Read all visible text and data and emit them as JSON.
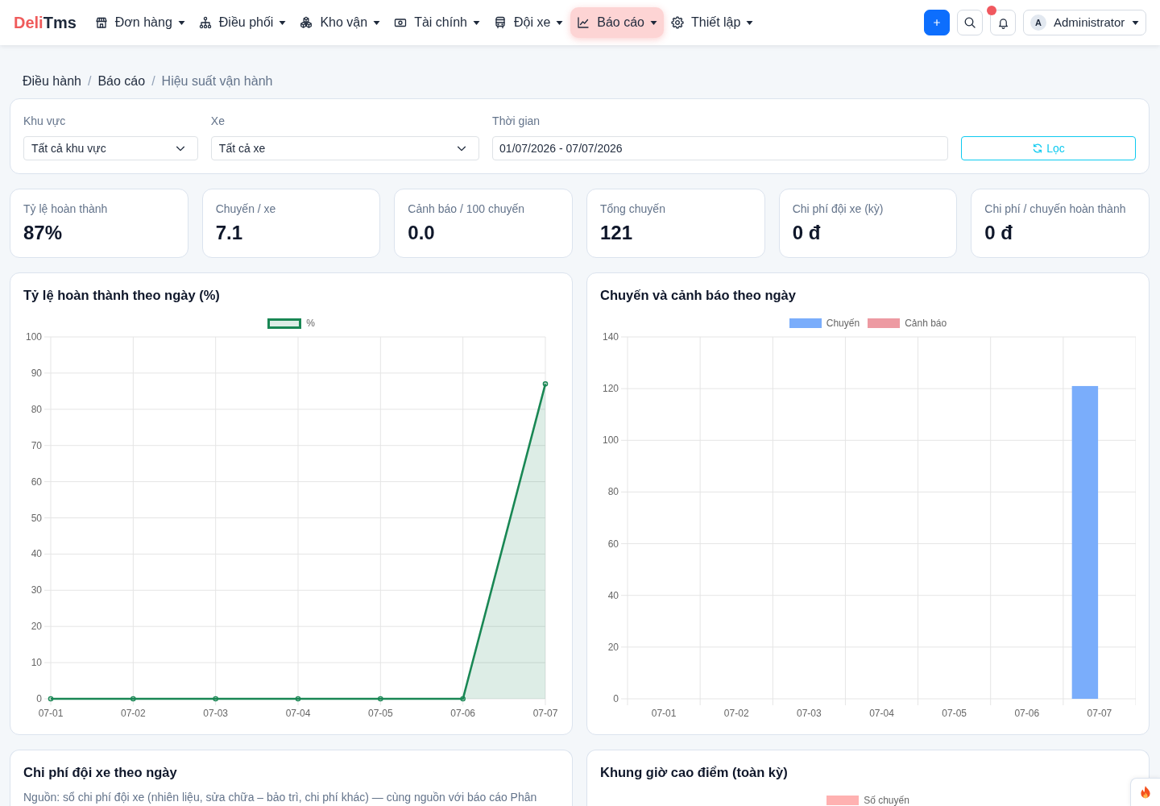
{
  "brand": {
    "accent": "Deli",
    "rest": "Tms"
  },
  "nav": [
    {
      "label": "Đơn hàng",
      "selected": false
    },
    {
      "label": "Điều phối",
      "selected": false
    },
    {
      "label": "Kho vận",
      "selected": false
    },
    {
      "label": "Tài chính",
      "selected": false
    },
    {
      "label": "Đội xe",
      "selected": false
    },
    {
      "label": "Báo cáo",
      "selected": true
    },
    {
      "label": "Thiết lập",
      "selected": false
    }
  ],
  "toolbar": {
    "notifications_unread": true,
    "user": {
      "initial": "A",
      "name": "Administrator"
    }
  },
  "breadcrumb": {
    "separator": "/",
    "items": [
      {
        "label": "Điều hành",
        "active": false
      },
      {
        "label": "Báo cáo",
        "active": false
      },
      {
        "label": "Hiệu suất vận hành",
        "active": true
      }
    ]
  },
  "filters": {
    "fields": [
      {
        "kind": "select",
        "label": "Khu vực",
        "value": "Tất cả khu vực"
      },
      {
        "kind": "select",
        "label": "Xe",
        "value": "Tất cả xe"
      },
      {
        "kind": "date_range",
        "label": "Thời gian",
        "value": "01/07/2026 - 07/07/2026"
      }
    ],
    "button": "Lọc"
  },
  "kpis": [
    {
      "label": "Tỷ lệ hoàn thành",
      "value": "87%"
    },
    {
      "label": "Chuyến / xe",
      "value": "7.1"
    },
    {
      "label": "Cảnh báo / 100 chuyến",
      "value": "0.0"
    },
    {
      "label": "Tổng chuyến",
      "value": "121"
    },
    {
      "label": "Chi phí đội xe (kỳ)",
      "value": "0 đ"
    },
    {
      "label": "Chi phí / chuyến hoàn thành",
      "value": "0 đ"
    }
  ],
  "charts": [
    {
      "title": "Tỷ lệ hoàn thành theo ngày (%)",
      "chart_data": {
        "type": "line",
        "grid": true,
        "categories": [
          "07-01",
          "07-02",
          "07-03",
          "07-04",
          "07-05",
          "07-06",
          "07-07"
        ],
        "series": [
          {
            "name": "%",
            "color": "#198754",
            "marker": "circle",
            "values": [
              0,
              0,
              0,
              0,
              0,
              0,
              87
            ]
          }
        ],
        "ylim": [
          0,
          100
        ],
        "yticks": [
          0,
          10,
          20,
          30,
          40,
          50,
          60,
          70,
          80,
          90,
          100
        ]
      }
    },
    {
      "title": "Chuyến và cảnh báo theo ngày",
      "chart_data": {
        "type": "bar",
        "grid": true,
        "categories": [
          "07-01",
          "07-02",
          "07-03",
          "07-04",
          "07-05",
          "07-06",
          "07-07"
        ],
        "series": [
          {
            "name": "Chuyến",
            "color": "#7aadfb",
            "values": [
              0,
              0,
              0,
              0,
              0,
              0,
              121
            ]
          },
          {
            "name": "Cảnh báo",
            "color": "#ed9aa2",
            "values": [
              0,
              0,
              0,
              0,
              0,
              0,
              0
            ]
          }
        ],
        "ylim": [
          0,
          140
        ],
        "yticks": [
          0,
          20,
          40,
          60,
          80,
          100,
          120,
          140
        ]
      }
    }
  ],
  "bottom_cards": [
    {
      "title": "Chi phí đội xe theo ngày",
      "note": "Nguồn: sổ chi phí đội xe (nhiên liệu, sửa chữa – bảo trì, chi phí khác) — cùng nguồn với báo cáo Phân"
    },
    {
      "title": "Khung giờ cao điểm (toàn kỳ)",
      "legend": [
        {
          "label": "Số chuyến",
          "color": "#ffb1b1"
        }
      ]
    }
  ]
}
